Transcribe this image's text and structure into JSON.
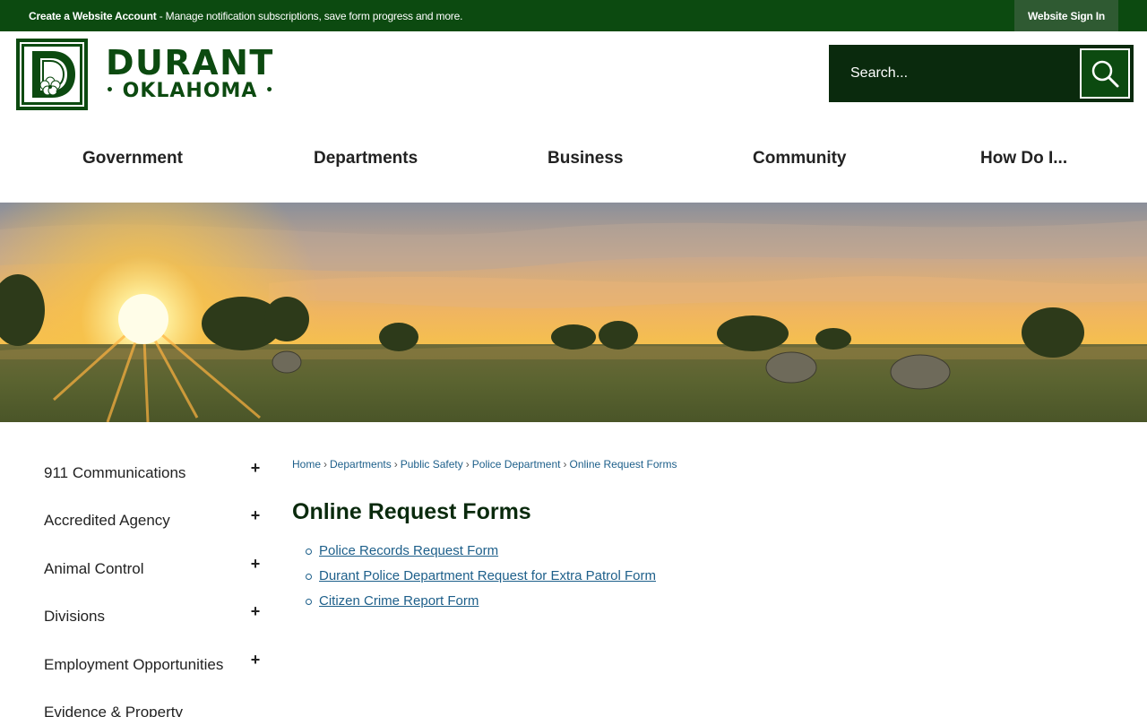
{
  "topbar": {
    "account_link": "Create a Website Account",
    "account_text": " - Manage notification subscriptions, save form progress and more.",
    "signin_label": "Website Sign In"
  },
  "logo": {
    "line1": "DURANT",
    "line2": "OKLAHOMA",
    "badge_letter": "D"
  },
  "search": {
    "placeholder": "Search..."
  },
  "nav": {
    "items": [
      "Government",
      "Departments",
      "Business",
      "Community",
      "How Do I..."
    ]
  },
  "sidebar": {
    "items": [
      {
        "label": "911 Communications"
      },
      {
        "label": "Accredited Agency"
      },
      {
        "label": "Animal Control"
      },
      {
        "label": "Divisions"
      },
      {
        "label": "Employment Opportunities"
      },
      {
        "label": "Evidence & Property"
      }
    ],
    "expand_symbol": "+"
  },
  "breadcrumb": [
    "Home",
    "Departments",
    "Public Safety",
    "Police Department",
    "Online Request Forms"
  ],
  "main": {
    "title": "Online Request Forms",
    "links": [
      "Police Records Request Form",
      "Durant Police Department Request for Extra Patrol Form",
      "Citizen Crime Report Form"
    ]
  },
  "colors": {
    "brand_green": "#0c4a10",
    "search_bg": "#0a2a0d",
    "link_blue": "#1d5f8a"
  }
}
